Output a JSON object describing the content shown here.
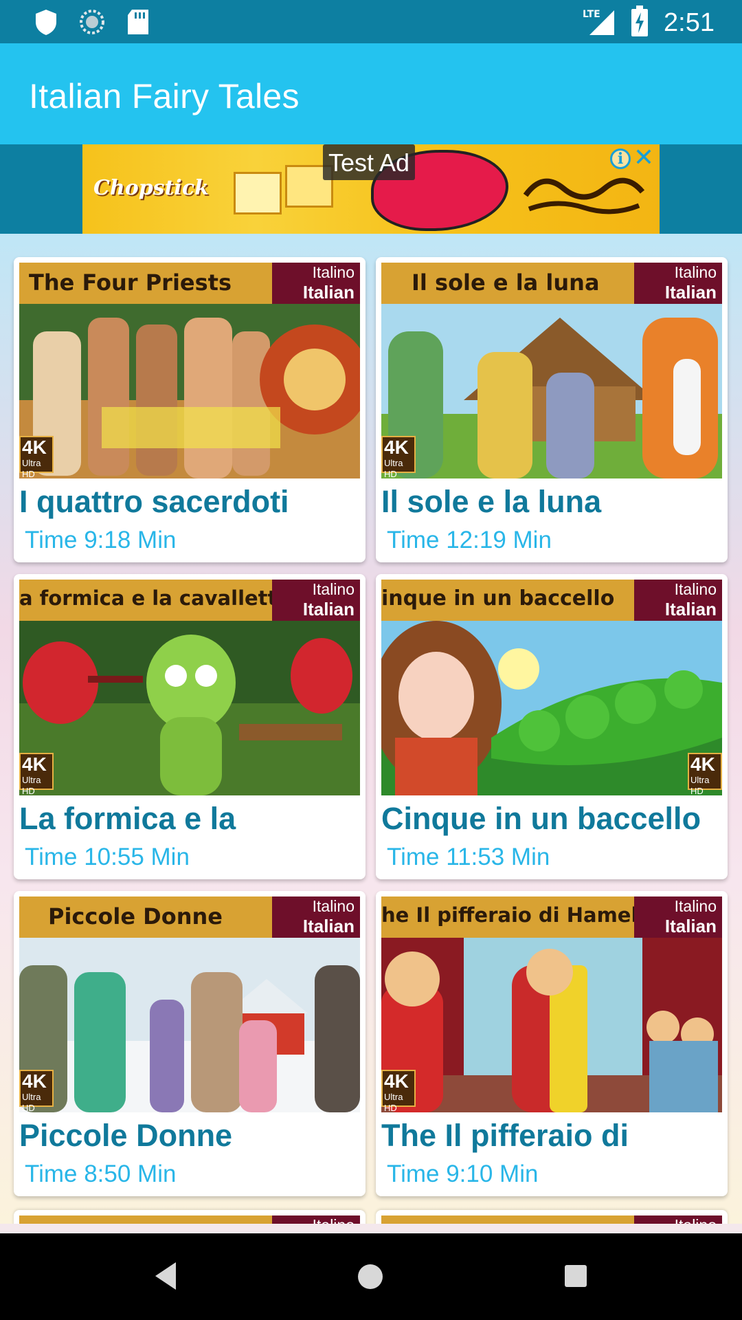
{
  "status_bar": {
    "time": "2:51",
    "network": "LTE",
    "icons": [
      "shield-icon",
      "sync-icon",
      "sd-card-icon",
      "signal-icon",
      "battery-charging-icon"
    ]
  },
  "app_bar": {
    "title": "Italian Fairy Tales"
  },
  "ad": {
    "label": "Test Ad",
    "logo_text": "Chopstick",
    "info_icon": "info-icon",
    "close_icon": "close-icon"
  },
  "cards": [
    {
      "banner_title": "The Four Priests",
      "lang_top": "Italino",
      "lang_bottom": "Italian",
      "title": "I quattro sacerdoti",
      "time": "Time 9:18 Min",
      "badge": "4K",
      "badge_sub": "Ultra HD"
    },
    {
      "banner_title": "Il sole e la luna",
      "lang_top": "Italino",
      "lang_bottom": "Italian",
      "title": "Il sole e la luna",
      "time": "Time 12:19 Min",
      "badge": "4K",
      "badge_sub": "Ultra HD"
    },
    {
      "banner_title": "a formica e la cavalletta",
      "lang_top": "Italino",
      "lang_bottom": "Italian",
      "title": "La formica e la",
      "time": "Time 10:55 Min",
      "badge": "4K",
      "badge_sub": "Ultra HD"
    },
    {
      "banner_title": "inque in un baccello",
      "lang_top": "Italino",
      "lang_bottom": "Italian",
      "title": "Cinque in un baccello",
      "time": "Time 11:53 Min",
      "badge": "4K",
      "badge_sub": "Ultra HD"
    },
    {
      "banner_title": "Piccole Donne",
      "lang_top": "Italino",
      "lang_bottom": "Italian",
      "title": "Piccole Donne",
      "time": "Time 8:50 Min",
      "badge": "4K",
      "badge_sub": "Ultra HD"
    },
    {
      "banner_title": "he  Il pifferaio di Hamelin",
      "lang_top": "Italino",
      "lang_bottom": "Italian",
      "title": "The Il pifferaio di",
      "time": "Time 9:10 Min",
      "badge": "4K",
      "badge_sub": "Ultra HD"
    }
  ],
  "partial_cards": [
    {
      "lang_top": "Italino"
    },
    {
      "lang_top": "Italino"
    }
  ],
  "nav_bar": {
    "icons": [
      "back-icon",
      "home-icon",
      "recents-icon"
    ]
  },
  "colors": {
    "status_bar": "#0d7fa1",
    "app_bar": "#24c3ef",
    "card_title": "#10799b",
    "card_time": "#29b6e8",
    "thumb_banner": "#d8a233",
    "thumb_lang": "#6e0f2a"
  }
}
